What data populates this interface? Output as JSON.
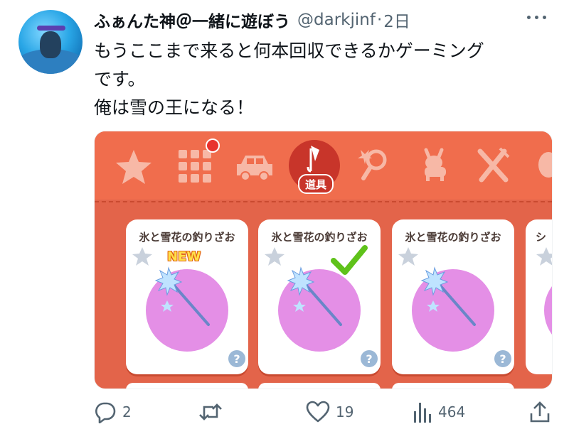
{
  "tweet": {
    "author_name": "ふぁんた神＠一緒に遊ぼう",
    "author_handle": "@darkjinf",
    "separator": "·",
    "timestamp": "2日",
    "text_lines": [
      "もうここまで来ると何本回収できるかゲーミング",
      "です。",
      "俺は雪の王になる！"
    ]
  },
  "media": {
    "active_tab_label": "道具",
    "tab_icons": [
      "star-icon",
      "grid-icon",
      "car-icon",
      "umbrella-icon",
      "magnifier-icon",
      "goat-icon",
      "utensils-icon",
      "fish-icon"
    ],
    "cards": [
      {
        "title": "氷と雪花の釣りざお",
        "badge": "NEW",
        "help": "?"
      },
      {
        "title": "氷と雪花の釣りざお",
        "badge": "",
        "help": "?"
      },
      {
        "title": "氷と雪花の釣りざお",
        "badge": "",
        "help": "?"
      }
    ],
    "partial_card_title": "シ",
    "colors": {
      "header": "#f06d4d",
      "body": "#e3644a",
      "circle": "#e48fe6"
    }
  },
  "actions": {
    "reply_count": "2",
    "retweet_count": "",
    "like_count": "19",
    "view_count": "464"
  }
}
